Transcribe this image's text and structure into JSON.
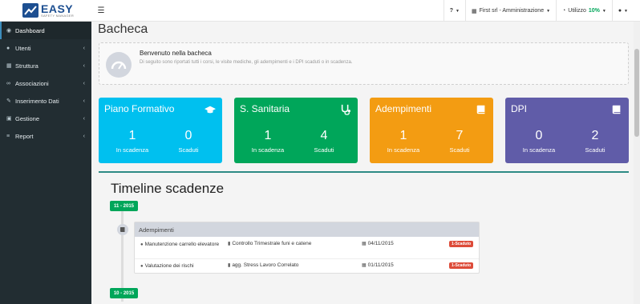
{
  "brand": {
    "title": "EASY",
    "subtitle": "SAFETY MANAGER"
  },
  "sidebar": {
    "items": [
      {
        "label": "Dashboard",
        "icon": "dashboard-icon",
        "active": true
      },
      {
        "label": "Utenti",
        "icon": "users-icon"
      },
      {
        "label": "Struttura",
        "icon": "building-icon"
      },
      {
        "label": "Associazioni",
        "icon": "link-icon"
      },
      {
        "label": "Inserimento Dati",
        "icon": "edit-icon"
      },
      {
        "label": "Gestione",
        "icon": "briefcase-icon"
      },
      {
        "label": "Report",
        "icon": "list-icon"
      }
    ]
  },
  "navbar": {
    "company": "First srl - Amministrazione",
    "usage_label": "Utilizzo",
    "usage_value": "10%",
    "help_icon": "question-icon",
    "user_icon": "user-icon"
  },
  "page": {
    "title": "Bacheca"
  },
  "welcome": {
    "title": "Benvenuto nella bacheca",
    "text": "Di seguito sono riportati tutti i corsi, le visite mediche, gli adempimenti e i DPI scaduti o in scadenza."
  },
  "cards": [
    {
      "title": "Piano Formativo",
      "color": "#00c0ef",
      "icon": "graduation-cap-icon",
      "in_scadenza": "1",
      "scaduti": "0"
    },
    {
      "title": "S. Sanitaria",
      "color": "#00a65a",
      "icon": "stethoscope-icon",
      "in_scadenza": "1",
      "scaduti": "4"
    },
    {
      "title": "Adempimenti",
      "color": "#f39c12",
      "icon": "book-icon",
      "in_scadenza": "1",
      "scaduti": "7"
    },
    {
      "title": "DPI",
      "color": "#605ca8",
      "icon": "book-icon",
      "in_scadenza": "0",
      "scaduti": "2"
    }
  ],
  "card_labels": {
    "in_scadenza": "In scadenza",
    "scaduti": "Scaduti"
  },
  "timeline": {
    "title": "Timeline scadenze",
    "dates": [
      "11 - 2015",
      "10 - 2015"
    ],
    "section": "Adempimenti",
    "rows": [
      {
        "item": "Manutenzione carrello elevatore",
        "task": "Controllo Trimestrale funi e catene",
        "date": "04/11/2015",
        "status": "1-Scaduto"
      },
      {
        "item": "Valutazione dei rischi",
        "task": "agg. Stress Lavoro Correlato",
        "date": "01/11/2015",
        "status": "1-Scaduto"
      }
    ]
  }
}
